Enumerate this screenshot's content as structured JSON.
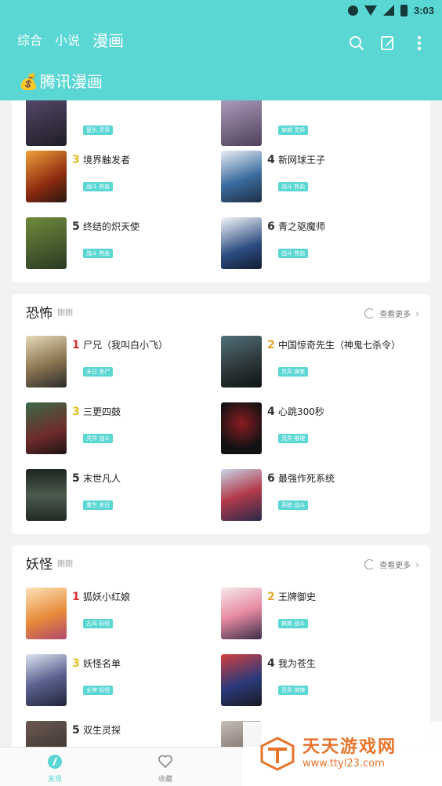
{
  "status_bar": {
    "time": "3:03"
  },
  "tabs": [
    {
      "label": "综合",
      "active": false
    },
    {
      "label": "小说",
      "active": false
    },
    {
      "label": "漫画",
      "active": true
    }
  ],
  "brand": {
    "icon": "money-bag",
    "name": "腾讯漫画"
  },
  "toolbar_icons": [
    "search-icon",
    "edit-icon",
    "more-vert-icon"
  ],
  "sections": [
    {
      "category": "",
      "subtitle": "",
      "more_label": "",
      "items": [
        {
          "rank": "",
          "title": "",
          "tag": "复仇 灵异",
          "cover_color": "#2a2733"
        },
        {
          "rank": "",
          "title": "",
          "tag": "穿越 灵异",
          "cover_color": "#6a5b73"
        },
        {
          "rank": "3",
          "title": "境界触发者",
          "tag": "战斗 热血",
          "cover_color": "#b84a16"
        },
        {
          "rank": "4",
          "title": "新网球王子",
          "tag": "战斗 热血",
          "cover_color": "#2f6a9b"
        },
        {
          "rank": "5",
          "title": "终结的炽天使",
          "tag": "战斗 热血",
          "cover_color": "#3e5a2a"
        },
        {
          "rank": "6",
          "title": "青之驱魔师",
          "tag": "战斗 热血",
          "cover_color": "#2b4775"
        }
      ]
    },
    {
      "category": "恐怖",
      "subtitle": "刚刚",
      "more_label": "查看更多",
      "items": [
        {
          "rank": "1",
          "title": "尸兄（我叫白小飞）",
          "tag": "末日 丧尸",
          "cover_color": "#b9a27a"
        },
        {
          "rank": "2",
          "title": "中国惊奇先生（神鬼七杀令）",
          "tag": "灵异 搞笑",
          "cover_color": "#3a4a4e"
        },
        {
          "rank": "3",
          "title": "三更四鼓",
          "tag": "灵异 战斗",
          "cover_color": "#6e3a3a"
        },
        {
          "rank": "4",
          "title": "心跳300秒",
          "tag": "灵异 推理",
          "cover_color": "#1b1b1e"
        },
        {
          "rank": "5",
          "title": "末世凡人",
          "tag": "重生 末日",
          "cover_color": "#3b4a3e"
        },
        {
          "rank": "6",
          "title": "最强作死系统",
          "tag": "系统 战斗",
          "cover_color": "#7b4a6a"
        }
      ]
    },
    {
      "category": "妖怪",
      "subtitle": "刚刚",
      "more_label": "查看更多",
      "items": [
        {
          "rank": "1",
          "title": "狐妖小红娘",
          "tag": "古风 妖怪",
          "cover_color": "#e7a95a"
        },
        {
          "rank": "2",
          "title": "王牌御史",
          "tag": "搞笑 战斗",
          "cover_color": "#e6a9b6"
        },
        {
          "rank": "3",
          "title": "妖怪名单",
          "tag": "女神 妖怪",
          "cover_color": "#4d4f6d"
        },
        {
          "rank": "4",
          "title": "我为苍生",
          "tag": "灵异 惊悚",
          "cover_color": "#a23a3a"
        },
        {
          "rank": "5",
          "title": "双生灵探",
          "tag": "",
          "cover_color": "#3a3330"
        },
        {
          "rank": "",
          "title": "",
          "tag": "",
          "cover_color": "#5a4e4a"
        }
      ]
    }
  ],
  "rank_colors": {
    "1": "#d9302b",
    "2": "#e0a72d",
    "3": "#e0c02a",
    "other": "#333333"
  },
  "accent": "#5ad6d3",
  "bottom_nav": [
    {
      "label": "发现",
      "icon": "discover-icon",
      "active": true
    },
    {
      "label": "收藏",
      "icon": "heart-icon",
      "active": false
    }
  ],
  "watermark": {
    "name": "天天游戏网",
    "url": "www.ttyl23.com"
  }
}
